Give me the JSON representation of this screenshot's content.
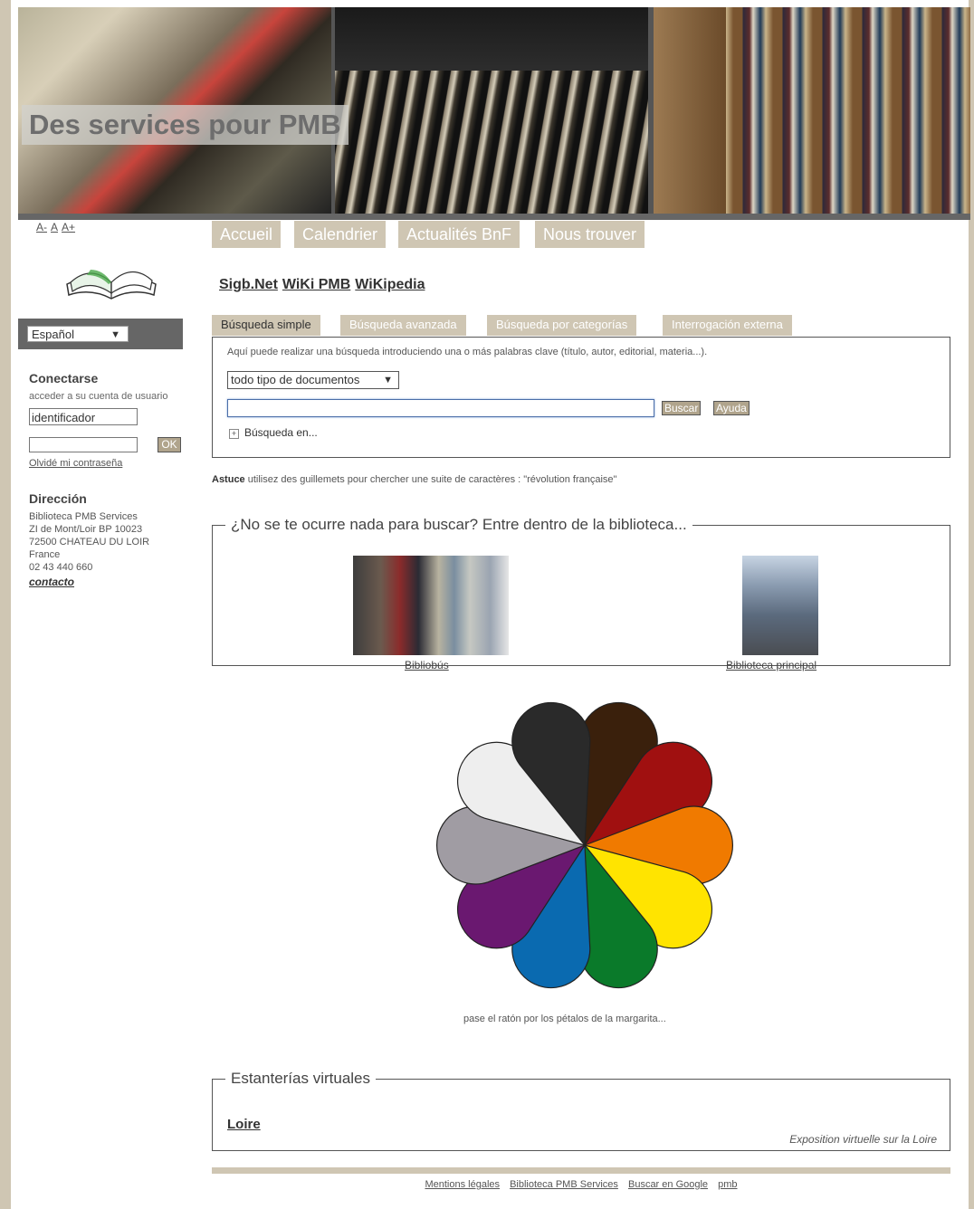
{
  "banner": {
    "title": "Des services pour PMB"
  },
  "accessibility": {
    "font_smaller": "A-",
    "font_normal": "A",
    "font_larger": "A+"
  },
  "language": {
    "selected": "Español"
  },
  "login": {
    "heading": "Conectarse",
    "subtitle": "acceder a su cuenta de usuario",
    "id_placeholder": "identificador",
    "ok_label": "OK",
    "forgot_label": "Olvidé mi contraseña"
  },
  "address": {
    "heading": "Dirección",
    "lines": [
      "Biblioteca PMB Services",
      "ZI de Mont/Loir BP 10023",
      "72500 CHATEAU DU LOIR",
      "France",
      "02 43 440 660"
    ],
    "contact_label": "contacto"
  },
  "nav": [
    "Accueil",
    "Calendrier",
    "Actualités BnF",
    "Nous trouver"
  ],
  "links": [
    "Sigb.Net",
    "WiKi PMB",
    "WiKipedia"
  ],
  "search": {
    "tabs": [
      "Búsqueda simple",
      "Búsqueda avanzada",
      "Búsqueda por categorías",
      "Interrogación externa"
    ],
    "intro": "Aquí puede realizar una búsqueda introduciendo una o más palabras clave (título, autor, editorial, materia...).",
    "doctype": "todo tipo de documentos",
    "query_value": "",
    "search_button": "Buscar",
    "help_button": "Ayuda",
    "advanced_toggle": "Búsqueda en..."
  },
  "tip": {
    "label": "Astuce",
    "text": "utilisez des guillemets pour chercher une suite de caractères : \"révolution française\""
  },
  "explore": {
    "legend": "¿No se te ocurre nada para buscar? Entre dentro de la biblioteca...",
    "items": [
      {
        "label": "Bibliobús"
      },
      {
        "label": "Biblioteca principal"
      }
    ]
  },
  "flower": {
    "caption": "pase el ratón por los pétalos de la margarita...",
    "petal_colors": [
      "#3a200c",
      "#a01010",
      "#f07a00",
      "#ffe400",
      "#0a7a2a",
      "#0a6ab0",
      "#6a1870",
      "#a09ca3",
      "#eeeeee",
      "#2a2a2a"
    ]
  },
  "shelves": {
    "legend": "Estanterías virtuales",
    "item_label": "Loire",
    "item_desc": "Exposition virtuelle sur la Loire"
  },
  "footer": [
    "Mentions légales",
    "Biblioteca PMB Services",
    "Buscar en Google",
    "pmb"
  ]
}
